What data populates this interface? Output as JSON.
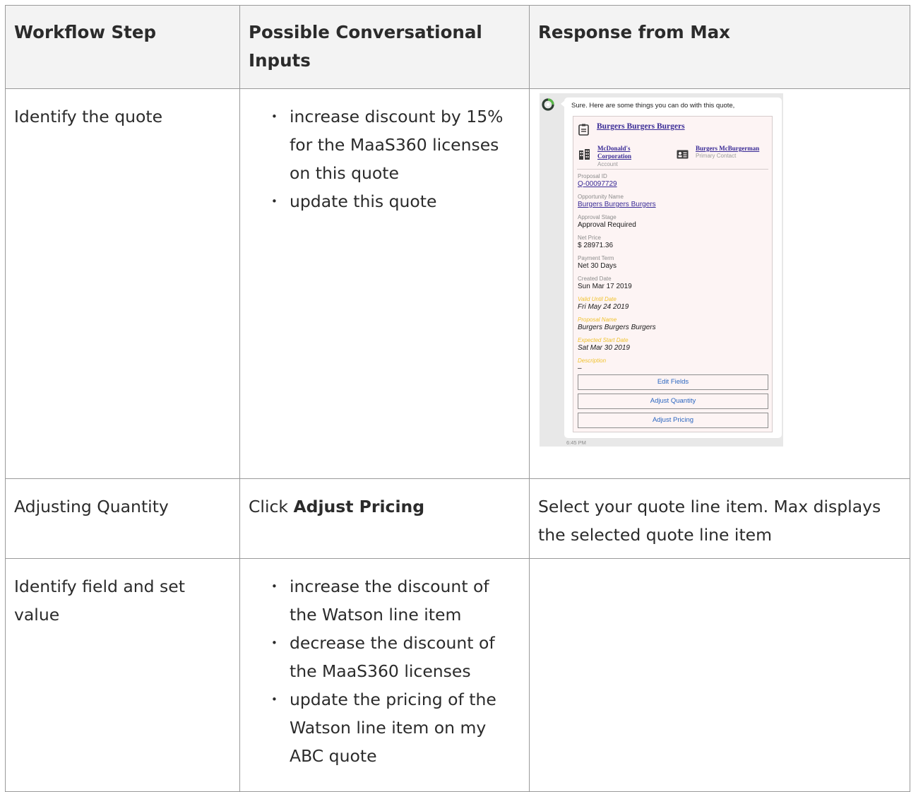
{
  "table": {
    "headers": [
      "Workflow Step",
      "Possible Conversational Inputs",
      "Response from Max"
    ],
    "rows": [
      {
        "step": "Identify the quote",
        "inputs": [
          "increase discount by 15% for the MaaS360 licenses on this quote",
          "update this quote"
        ]
      },
      {
        "step": "Adjusting Quantity",
        "input_prefix": "Click ",
        "input_bold": "Adjust Pricing",
        "response": "Select your quote line item. Max displays the selected quote line item"
      },
      {
        "step": "Identify field and set value",
        "inputs": [
          "increase the discount of the Watson line item",
          "decrease the discount of the MaaS360 licenses",
          "update the pricing of the Watson line item on my ABC quote"
        ],
        "response": ""
      }
    ]
  },
  "chat": {
    "intro": "Sure. Here are some things you can do with this quote,",
    "quote_title": "Burgers Burgers Burgers",
    "account": {
      "name": "McDonald's Corporation",
      "label": "Account"
    },
    "contact": {
      "name": "Burgers McBurgerman",
      "label": "Primary Contact"
    },
    "fields": [
      {
        "label": "Proposal ID",
        "value": "Q-00097729"
      },
      {
        "label": "Opportunity Name",
        "value": "Burgers Burgers Burgers"
      },
      {
        "label": "Approval Stage",
        "value": "Approval Required"
      },
      {
        "label": "Net Price",
        "value": "$ 28971.36"
      },
      {
        "label": "Payment Term",
        "value": "Net 30 Days"
      },
      {
        "label": "Created Date",
        "value": "Sun Mar 17 2019"
      },
      {
        "label": "Valid Until Date",
        "value": "Fri May 24 2019"
      },
      {
        "label": "Proposal Name",
        "value": "Burgers Burgers Burgers"
      },
      {
        "label": "Expected Start Date",
        "value": "Sat Mar 30 2019"
      },
      {
        "label": "Description",
        "value": "–"
      }
    ],
    "buttons": [
      "Edit Fields",
      "Adjust Quantity",
      "Adjust Pricing"
    ],
    "time": "6:45 PM",
    "colors": {
      "link": "#3a2b96",
      "highlight_label": "#f0c22e",
      "button_text": "#2a66c0",
      "card_bg": "#fdf4f4"
    }
  }
}
